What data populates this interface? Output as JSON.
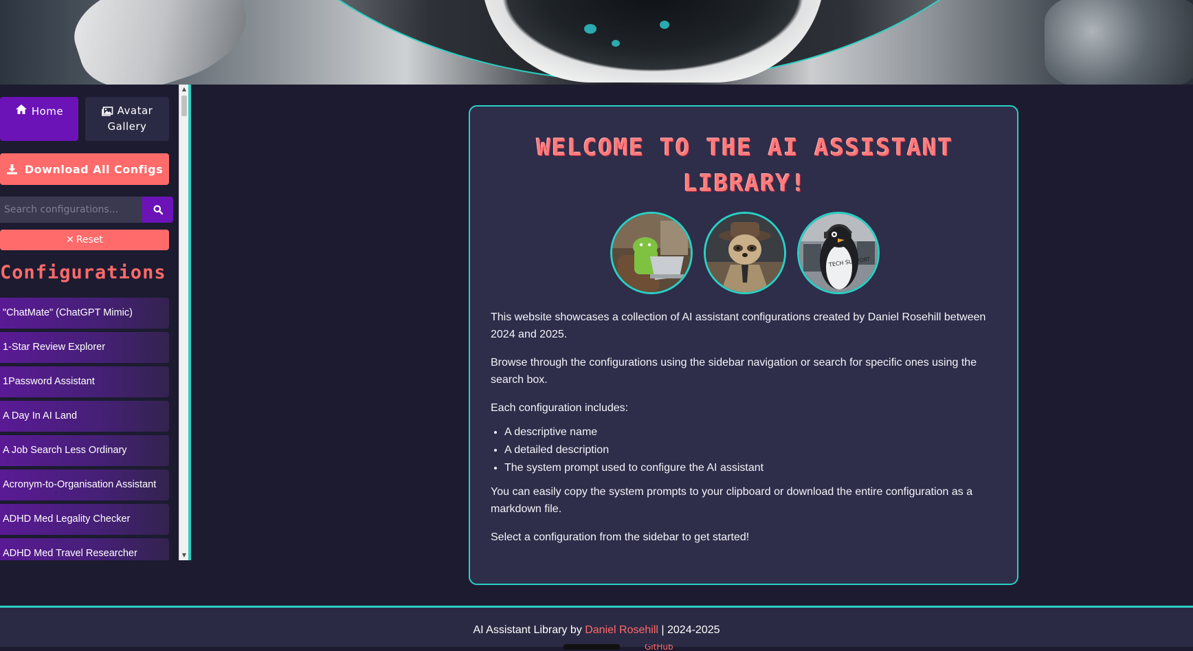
{
  "nav": {
    "home_label": "Home",
    "avatar_gallery_label": "Avatar Gallery"
  },
  "sidebar": {
    "download_label": "Download All Configs",
    "search_placeholder": "Search configurations...",
    "reset_label": "Reset",
    "heading": "Configurations",
    "items": [
      "\"ChatMate\" (ChatGPT Mimic)",
      "1-Star Review Explorer",
      "1Password Assistant",
      "A Day In AI Land",
      "A Job Search Less Ordinary",
      "Acronym-to-Organisation Assistant",
      "ADHD Med Legality Checker",
      "ADHD Med Travel Researcher"
    ]
  },
  "main": {
    "title": "Welcome to the AI Assistant Library!",
    "intro": "This website showcases a collection of AI assistant configurations created by Daniel Rosehill between 2024 and 2025.",
    "browse": "Browse through the configurations using the sidebar navigation or search for specific ones using the search box.",
    "includes_heading": "Each configuration includes:",
    "includes": [
      "A descriptive name",
      "A detailed description",
      "The system prompt used to configure the AI assistant"
    ],
    "copy_note": "You can easily copy the system prompts to your clipboard or download the entire configuration as a markdown file.",
    "select_note": "Select a configuration from the sidebar to get started!",
    "avatar_sign_text": "TECH SUPPORT"
  },
  "footer": {
    "prefix": "AI Assistant Library by",
    "author": "Daniel Rosehill",
    "suffix": "| 2024-2025",
    "badge_text": "GitHub"
  },
  "colors": {
    "accent": "#2ad0c4",
    "coral": "#ff6a6a",
    "purple": "#6b13b7",
    "background": "#1c1b30",
    "card": "#2e2d4a"
  }
}
